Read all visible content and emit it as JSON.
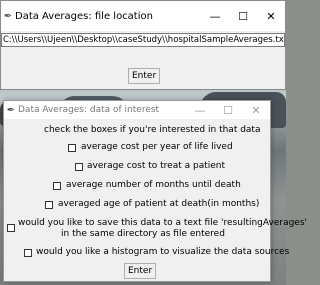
{
  "window1": {
    "title": "Data Averages: file location",
    "path_value": "C:\\\\Users\\\\Ujeen\\\\Desktop\\\\caseStudy\\\\hospitalSampleAverages.txt",
    "enter_label": "Enter",
    "controls": {
      "minimize": "—",
      "maximize": "☐",
      "close": "✕"
    }
  },
  "window2": {
    "title": "Data Averages: data of interest",
    "instruction": "check the boxes if you're interested in that data",
    "options": [
      "average cost per year of life lived",
      "average cost to treat a patient",
      "average number of months until death",
      "averaged age of patient at death(in months)"
    ],
    "save_line1": "would you like to save this data to a text file 'resultingAverages'",
    "save_line2": "in the same directory as file entered",
    "histogram_label": "would you like a histogram to visualize the data sources",
    "enter_label": "Enter",
    "controls": {
      "minimize": "—",
      "maximize": "☐",
      "close": "✕"
    }
  }
}
